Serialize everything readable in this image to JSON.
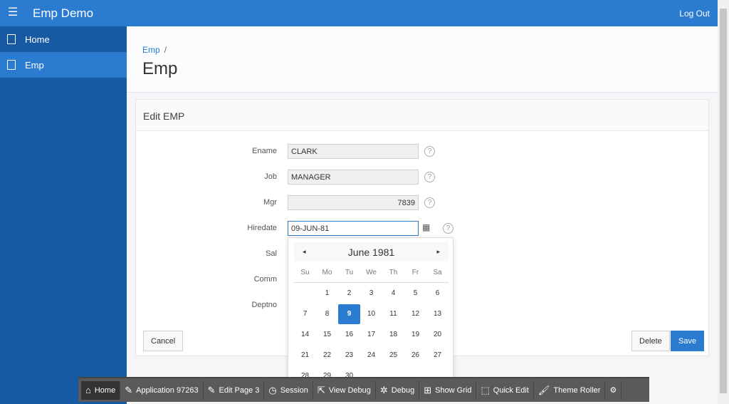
{
  "header": {
    "menu_icon": "hamburger-icon",
    "app_title": "Emp Demo",
    "logout": "Log Out"
  },
  "sidebar": {
    "items": [
      {
        "label": "Home",
        "icon": "page-icon",
        "active": false
      },
      {
        "label": "Emp",
        "icon": "page-icon",
        "active": true
      }
    ]
  },
  "breadcrumb": {
    "parent": "Emp",
    "separator": "/"
  },
  "page_title": "Emp",
  "region": {
    "title": "Edit EMP",
    "fields": [
      {
        "label": "Ename",
        "value": "CLARK"
      },
      {
        "label": "Job",
        "value": "MANAGER"
      },
      {
        "label": "Mgr",
        "value": "7839"
      },
      {
        "label": "Hiredate",
        "value": "09-JUN-81"
      },
      {
        "label": "Sal",
        "value": ""
      },
      {
        "label": "Comm",
        "value": ""
      },
      {
        "label": "Deptno",
        "value": ""
      }
    ],
    "help_glyph": "?",
    "buttons": {
      "cancel": "Cancel",
      "delete": "Delete",
      "save": "Save"
    }
  },
  "calendar": {
    "title": "June 1981",
    "prev": "◂",
    "next": "▸",
    "weekdays": [
      "Su",
      "Mo",
      "Tu",
      "We",
      "Th",
      "Fr",
      "Sa"
    ],
    "first_weekday": 1,
    "days": 30,
    "selected": 9,
    "accent": "#2b7bd1"
  },
  "devbar": {
    "items": [
      {
        "label": "Home",
        "icon": "⌂"
      },
      {
        "label": "Application 97263",
        "icon": "✎"
      },
      {
        "label": "Edit Page 3",
        "icon": "✎"
      },
      {
        "label": "Session",
        "icon": "◷"
      },
      {
        "label": "View Debug",
        "icon": "⇱"
      },
      {
        "label": "Debug",
        "icon": "✲"
      },
      {
        "label": "Show Grid",
        "icon": "⊞"
      },
      {
        "label": "Quick Edit",
        "icon": "⬚"
      },
      {
        "label": "Theme Roller",
        "icon": "🖌"
      }
    ],
    "settings_icon": "⚙"
  }
}
